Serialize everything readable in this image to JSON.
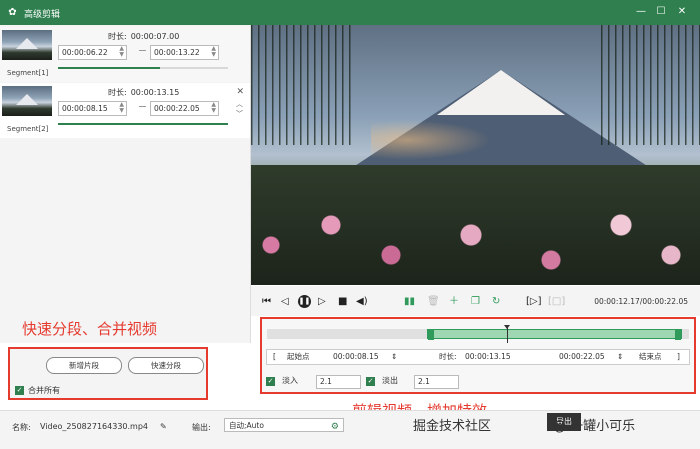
{
  "window": {
    "title": "高级剪辑",
    "logo_icon": "rabbit-icon",
    "minimize": "—",
    "maximize": "☐",
    "close": "✕"
  },
  "segments": [
    {
      "label": "Segment[1]",
      "duration_label": "时长:",
      "duration": "00:00:07.00",
      "start": "00:00:06.22",
      "end": "00:00:13.22"
    },
    {
      "label": "Segment[2]",
      "duration_label": "时长:",
      "duration": "00:00:13.15",
      "start": "00:00:08.15",
      "end": "00:00:22.05",
      "close": "✕",
      "up": "︿",
      "down": "﹀"
    }
  ],
  "player": {
    "controls": [
      "skip-start-icon",
      "step-back-icon",
      "pause-icon",
      "step-forward-icon",
      "stop-icon",
      "volume-icon",
      "split-icon",
      "delete-icon",
      "add-icon",
      "copy-icon",
      "rotate-icon",
      "mark-in-icon",
      "mark-out-icon"
    ],
    "current_time": "00:00:12.17",
    "total_time": "00:00:22.05",
    "time_sep": "/"
  },
  "edit": {
    "start_btn": "起始点",
    "start_time": "00:00:08.15",
    "duration_label": "时长:",
    "duration": "00:00:13.15",
    "end_time": "00:00:22.05",
    "end_btn": "结束点",
    "fade_in_label": "淡入",
    "fade_in_value": "2.1",
    "fade_out_label": "淡出",
    "fade_out_value": "2.1",
    "bracket_left": "[",
    "bracket_right": "]"
  },
  "left_panel": {
    "add_segment": "新增片段",
    "quick_split": "快速分段",
    "merge_all": "合并所有"
  },
  "annotations": {
    "left": "快速分段、合并视频",
    "right": "剪辑视频、增加特效"
  },
  "bottom": {
    "name_label": "名称:",
    "file_name": "Video_250827164330.mp4",
    "output_label": "输出:",
    "output_value": "自动;Auto"
  },
  "watermark": {
    "text1": "掘金技术社区",
    "text2": "@ 一罐小可乐",
    "export": "导出"
  },
  "colors": {
    "brand": "#2f7f4f",
    "annotation_red": "#e53b2f",
    "selection": "#9fd7b2"
  }
}
